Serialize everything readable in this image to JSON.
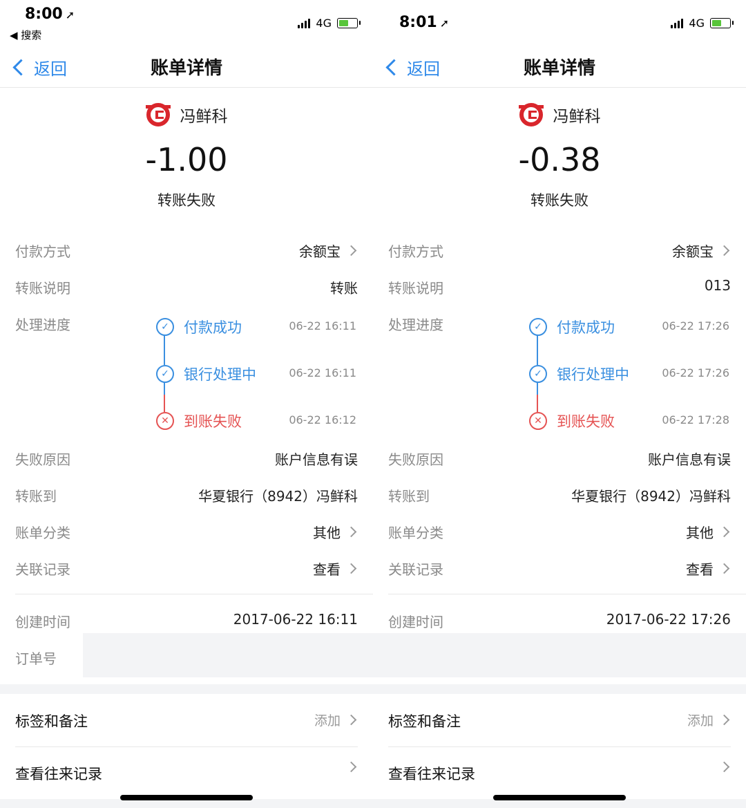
{
  "panels": [
    {
      "status_bar": {
        "time": "8:00",
        "back_app": "◀ 搜索",
        "network": "4G"
      },
      "nav": {
        "back": "返回",
        "title": "账单详情"
      },
      "payee": "冯鲜科",
      "amount": "-1.00",
      "status": "转账失败",
      "rows": {
        "payment_method": {
          "label": "付款方式",
          "value": "余额宝"
        },
        "transfer_note": {
          "label": "转账说明",
          "value": "转账"
        },
        "progress_label": "处理进度",
        "fail_reason": {
          "label": "失败原因",
          "value": "账户信息有误"
        },
        "transfer_to": {
          "label": "转账到",
          "value": "华夏银行（8942）冯鲜科"
        },
        "category": {
          "label": "账单分类",
          "value": "其他"
        },
        "related": {
          "label": "关联记录",
          "value": "查看"
        },
        "created": {
          "label": "创建时间",
          "value": "2017-06-22 16:11"
        },
        "order_no": {
          "label": "订单号"
        }
      },
      "progress": [
        {
          "label": "付款成功",
          "time": "06-22 16:11",
          "state": "done"
        },
        {
          "label": "银行处理中",
          "time": "06-22 16:11",
          "state": "done"
        },
        {
          "label": "到账失败",
          "time": "06-22 16:12",
          "state": "fail"
        }
      ],
      "tags": {
        "label": "标签和备注",
        "value": "添加"
      },
      "history": {
        "label": "查看往来记录"
      }
    },
    {
      "status_bar": {
        "time": "8:01",
        "network": "4G"
      },
      "nav": {
        "back": "返回",
        "title": "账单详情"
      },
      "payee": "冯鲜科",
      "amount": "-0.38",
      "status": "转账失败",
      "rows": {
        "payment_method": {
          "label": "付款方式",
          "value": "余额宝"
        },
        "transfer_note": {
          "label": "转账说明",
          "value": "013"
        },
        "progress_label": "处理进度",
        "fail_reason": {
          "label": "失败原因",
          "value": "账户信息有误"
        },
        "transfer_to": {
          "label": "转账到",
          "value": "华夏银行（8942）冯鲜科"
        },
        "category": {
          "label": "账单分类",
          "value": "其他"
        },
        "related": {
          "label": "关联记录",
          "value": "查看"
        },
        "created": {
          "label": "创建时间",
          "value": "2017-06-22 17:26"
        }
      },
      "progress": [
        {
          "label": "付款成功",
          "time": "06-22 17:26",
          "state": "done"
        },
        {
          "label": "银行处理中",
          "time": "06-22 17:26",
          "state": "done"
        },
        {
          "label": "到账失败",
          "time": "06-22 17:28",
          "state": "fail"
        }
      ],
      "tags": {
        "label": "标签和备注",
        "value": "添加"
      },
      "history": {
        "label": "查看往来记录"
      }
    }
  ],
  "colors": {
    "accent": "#2f89e9",
    "fail": "#e55353",
    "muted": "#8a8a8a",
    "logo": "#d9262c"
  }
}
